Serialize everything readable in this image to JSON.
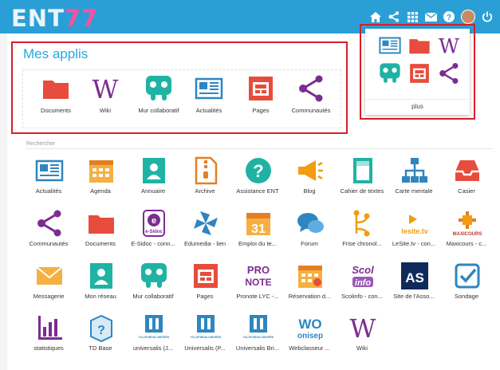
{
  "header": {
    "logo_text": "ENT",
    "logo_num": "77"
  },
  "topbar_icons": [
    "home-icon",
    "share-icon",
    "apps-grid-icon",
    "mail-icon",
    "help-icon",
    "avatar",
    "power-icon"
  ],
  "mes_applis": {
    "title": "Mes applis",
    "apps": [
      {
        "label": "Documents",
        "icon": "folder-icon"
      },
      {
        "label": "Wiki",
        "icon": "wiki-icon"
      },
      {
        "label": "Mur collaboratif",
        "icon": "collab-wall-icon"
      },
      {
        "label": "Actualités",
        "icon": "news-icon"
      },
      {
        "label": "Pages",
        "icon": "pages-icon"
      },
      {
        "label": "Communautés",
        "icon": "community-icon"
      }
    ]
  },
  "plus_panel": {
    "label": "plus",
    "icons": [
      "news-icon",
      "folder-icon",
      "wiki-icon",
      "collab-wall-icon",
      "pages-icon",
      "community-icon"
    ]
  },
  "search": {
    "placeholder": "Rechercher"
  },
  "all_apps": [
    {
      "label": "Actualités",
      "icon": "news-icon"
    },
    {
      "label": "Agenda",
      "icon": "calendar-icon"
    },
    {
      "label": "Annuaire",
      "icon": "directory-icon"
    },
    {
      "label": "Archive",
      "icon": "archive-icon"
    },
    {
      "label": "Assistance ENT",
      "icon": "help-icon"
    },
    {
      "label": "Blog",
      "icon": "megaphone-icon"
    },
    {
      "label": "Cahier de textes",
      "icon": "notebook-icon"
    },
    {
      "label": "Carte mentale",
      "icon": "mindmap-icon"
    },
    {
      "label": "Casier",
      "icon": "inbox-icon"
    },
    {
      "label": "Communautés",
      "icon": "community-icon"
    },
    {
      "label": "Documents",
      "icon": "folder-icon"
    },
    {
      "label": "E-Sidoc - conn...",
      "icon": "esidoc-icon"
    },
    {
      "label": "Edumedia - lien",
      "icon": "edumedia-icon"
    },
    {
      "label": "Emploi du te...",
      "icon": "timetable-icon"
    },
    {
      "label": "Forum",
      "icon": "forum-icon"
    },
    {
      "label": "Frise chronol...",
      "icon": "timeline-icon"
    },
    {
      "label": "LeSite.tv - con...",
      "icon": "lesitetv-icon"
    },
    {
      "label": "Maxicours - c...",
      "icon": "maxicours-icon"
    },
    {
      "label": "Messagerie",
      "icon": "mail-icon"
    },
    {
      "label": "Mon réseau",
      "icon": "network-icon"
    },
    {
      "label": "Mur collaboratif",
      "icon": "collab-wall-icon"
    },
    {
      "label": "Pages",
      "icon": "pages-icon"
    },
    {
      "label": "Pronote LYC -...",
      "icon": "pronote-icon"
    },
    {
      "label": "Réservation d...",
      "icon": "reservation-icon"
    },
    {
      "label": "Scolinfo - con...",
      "icon": "scolinfo-icon"
    },
    {
      "label": "Site de l'Asso...",
      "icon": "as-icon"
    },
    {
      "label": "Sondage",
      "icon": "poll-icon"
    },
    {
      "label": "statistiques",
      "icon": "stats-icon"
    },
    {
      "label": "TD Base",
      "icon": "tdbase-icon"
    },
    {
      "label": "universalis (J...",
      "icon": "universalis-icon"
    },
    {
      "label": "Universalis (P...",
      "icon": "universalis-icon"
    },
    {
      "label": "Universalis Bri...",
      "icon": "universalis-icon"
    },
    {
      "label": "Webclasseur ...",
      "icon": "onisep-icon"
    },
    {
      "label": "Wiki",
      "icon": "wiki-icon"
    }
  ],
  "icon_texts": {
    "wiki": "W",
    "pronote_a": "PRO",
    "pronote_b": "NOTE",
    "scol_a": "Scol",
    "scol_b": "info",
    "as": "AS",
    "lesite": "lesite.tv",
    "maxicours": "MAXICOURS",
    "calendar_day": "31",
    "esidoc": "e-Sidoc",
    "td": "?",
    "univ": "ENCYCLOPÆDIA UNIVERSALIS",
    "onisep_a": "WO",
    "onisep_b": "onisep"
  },
  "colors": {
    "topbar": "#2a9fd6",
    "accent_red": "#d61e2c",
    "title_blue": "#29a8e0",
    "teal": "#1fb3a4",
    "purple": "#7b2d90",
    "orange": "#f39c12",
    "red": "#e74c3c",
    "blue": "#2e86c1"
  }
}
